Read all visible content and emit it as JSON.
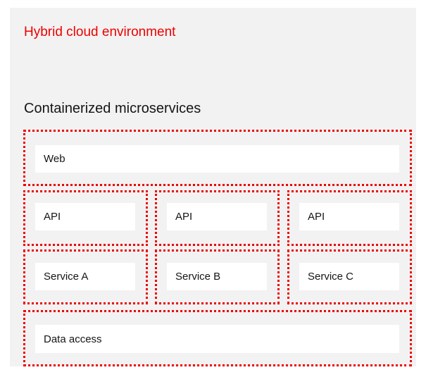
{
  "environment": {
    "title": "Hybrid cloud environment",
    "accent_color": "#ee0000",
    "background_color": "#f2f2f2"
  },
  "microservices": {
    "title": "Containerized microservices",
    "web": "Web",
    "apis": [
      "API",
      "API",
      "API"
    ],
    "services": [
      "Service A",
      "Service B",
      "Service C"
    ],
    "data_access": "Data access"
  }
}
